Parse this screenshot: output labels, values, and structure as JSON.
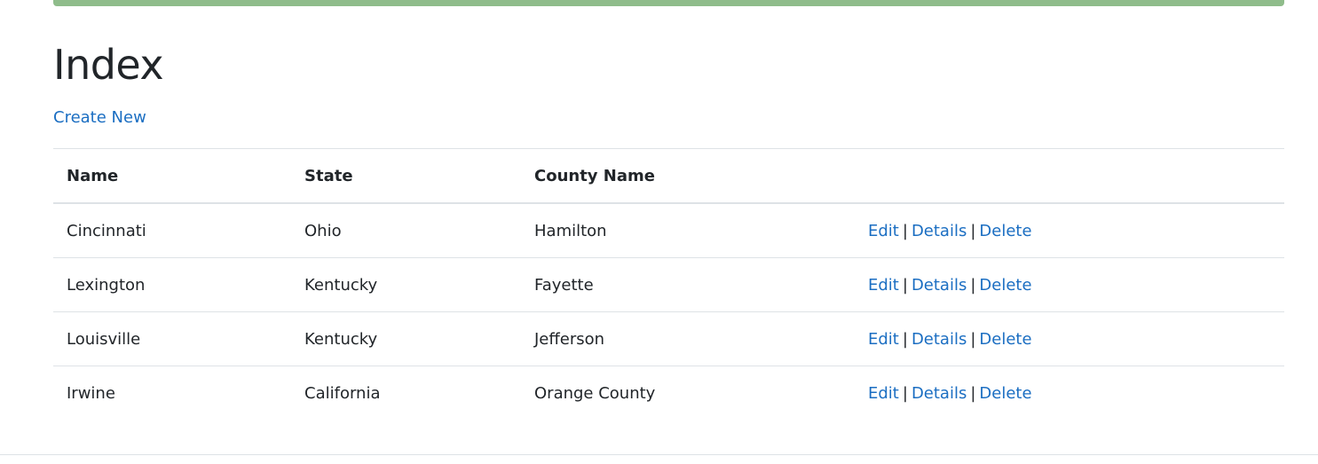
{
  "page": {
    "title": "Index",
    "create_link": "Create New"
  },
  "table": {
    "headers": [
      "Name",
      "State",
      "County Name",
      ""
    ],
    "rows": [
      {
        "name": "Cincinnati",
        "state": "Ohio",
        "county": "Hamilton"
      },
      {
        "name": "Lexington",
        "state": "Kentucky",
        "county": "Fayette"
      },
      {
        "name": "Louisville",
        "state": "Kentucky",
        "county": "Jefferson"
      },
      {
        "name": "Irwine",
        "state": "California",
        "county": "Orange County"
      }
    ],
    "actions": {
      "edit": "Edit",
      "details": "Details",
      "delete": "Delete",
      "separator": "|"
    }
  },
  "colors": {
    "link": "#1b6ec2",
    "top_bar": "#8fbc8b",
    "border": "#dee2e6"
  }
}
